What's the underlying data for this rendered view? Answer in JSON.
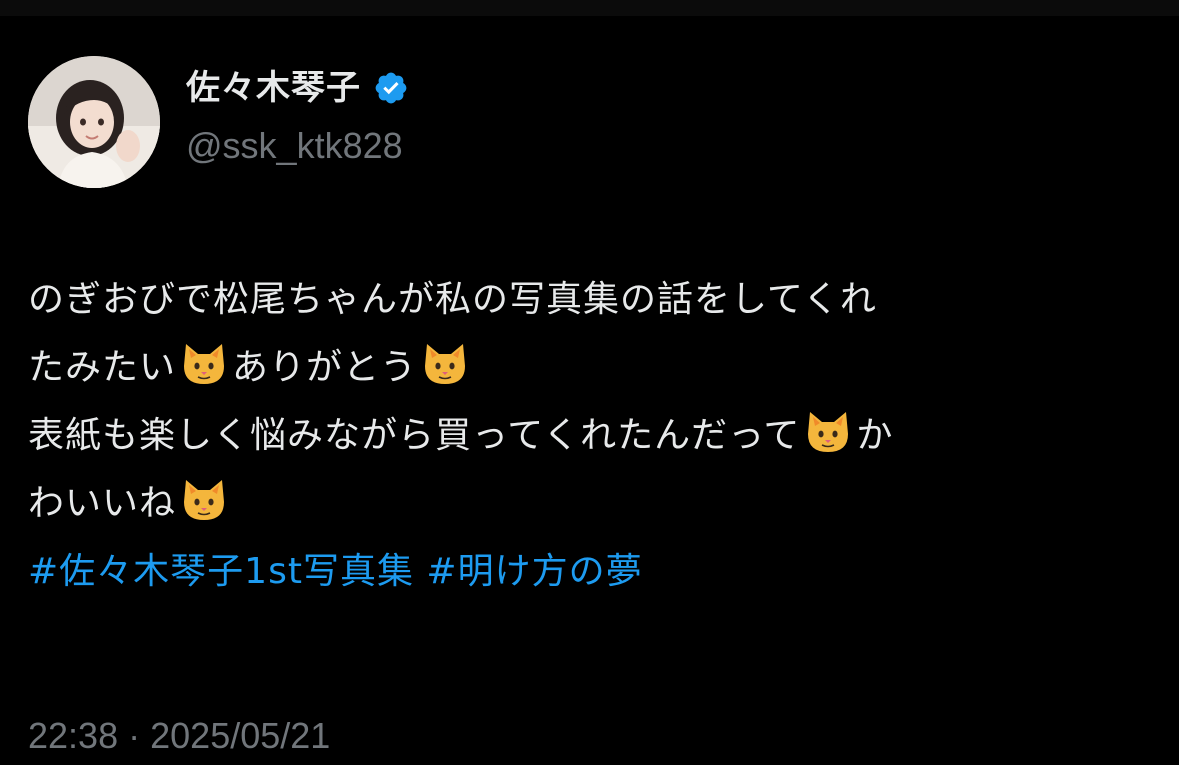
{
  "user": {
    "display_name": "佐々木琴子",
    "handle": "@ssk_ktk828",
    "verified": true
  },
  "tweet": {
    "lines": [
      [
        "のぎおびで松尾ちゃんが私の写真集の話をしてくれ"
      ],
      [
        "たみたい",
        "cat-emoji",
        "ありがとう",
        "cat-emoji"
      ],
      [
        "表紙も楽しく悩みながら買ってくれたんだって",
        "cat-emoji",
        "か"
      ],
      [
        "わいいね",
        "cat-emoji"
      ]
    ],
    "segments": {
      "l1": "のぎおびで松尾ちゃんが私の写真集の話をしてくれ",
      "l2a": "たみたい",
      "l2b": "ありがとう",
      "l3a": "表紙も楽しく悩みながら買ってくれたんだって",
      "l3b": "か",
      "l4a": "わいいね"
    },
    "hashtags": [
      "#佐々木琴子1st写真集",
      "#明け方の夢"
    ],
    "time": "22:38",
    "separator": "·",
    "date": "2025/05/21"
  },
  "colors": {
    "background": "#000000",
    "text": "#e7e9ea",
    "secondary": "#71767b",
    "link": "#1d9bf0",
    "verified_badge": "#1d9bf0"
  },
  "icons": [
    "verified-badge-icon",
    "cat-emoji-icon"
  ]
}
